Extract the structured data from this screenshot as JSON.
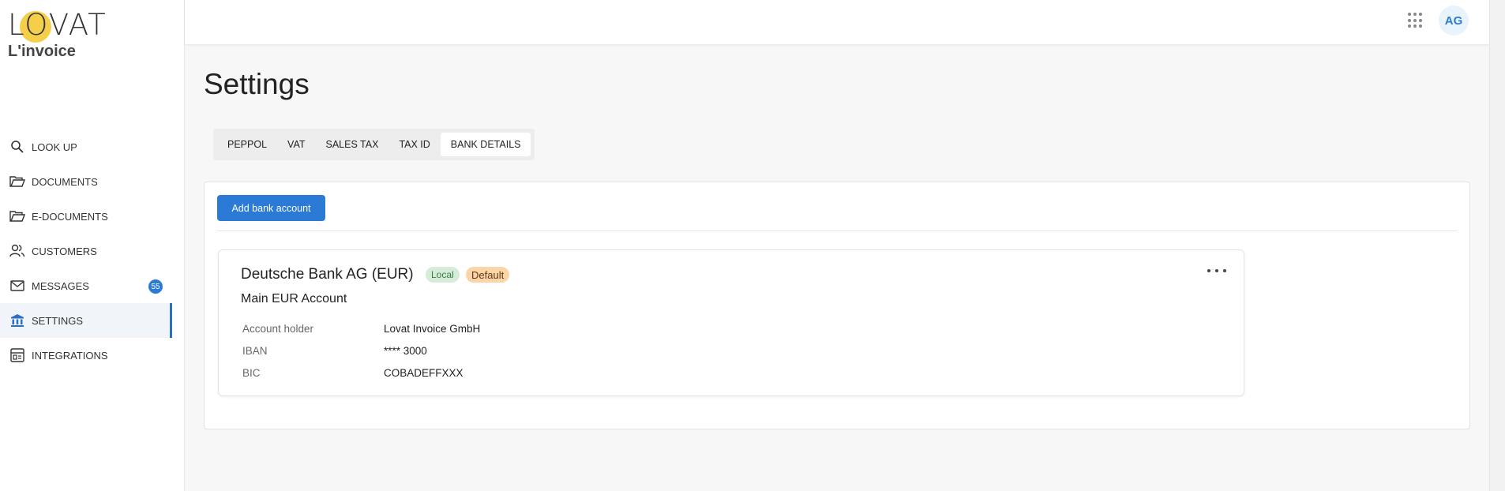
{
  "brand": {
    "logo_text": "LOVAT",
    "subtitle": "L'invoice"
  },
  "sidebar": {
    "items": [
      {
        "label": "LOOK UP"
      },
      {
        "label": "DOCUMENTS"
      },
      {
        "label": "E-DOCUMENTS"
      },
      {
        "label": "CUSTOMERS"
      },
      {
        "label": "MESSAGES",
        "badge": "55"
      },
      {
        "label": "SETTINGS",
        "active": true
      },
      {
        "label": "INTEGRATIONS"
      }
    ]
  },
  "header": {
    "avatar_initials": "AG"
  },
  "page": {
    "title": "Settings"
  },
  "tabs": [
    {
      "label": "PEPPOL"
    },
    {
      "label": "VAT"
    },
    {
      "label": "SALES TAX"
    },
    {
      "label": "TAX ID"
    },
    {
      "label": "BANK DETAILS",
      "active": true
    }
  ],
  "actions": {
    "add_bank_account": "Add bank account"
  },
  "bank_card": {
    "title": "Deutsche Bank AG (EUR)",
    "chip_local": "Local",
    "chip_default": "Default",
    "subtitle": "Main EUR Account",
    "fields": [
      {
        "key": "Account holder",
        "value": "Lovat Invoice GmbH"
      },
      {
        "key": "IBAN",
        "value": "**** 3000"
      },
      {
        "key": "BIC",
        "value": "COBADEFFXXX"
      }
    ]
  },
  "colors": {
    "accent": "#2b7ad6",
    "logo_dot": "#f5cf4a",
    "chip_local_bg": "#d6ecd8",
    "chip_default_bg": "#fbd5a8"
  }
}
